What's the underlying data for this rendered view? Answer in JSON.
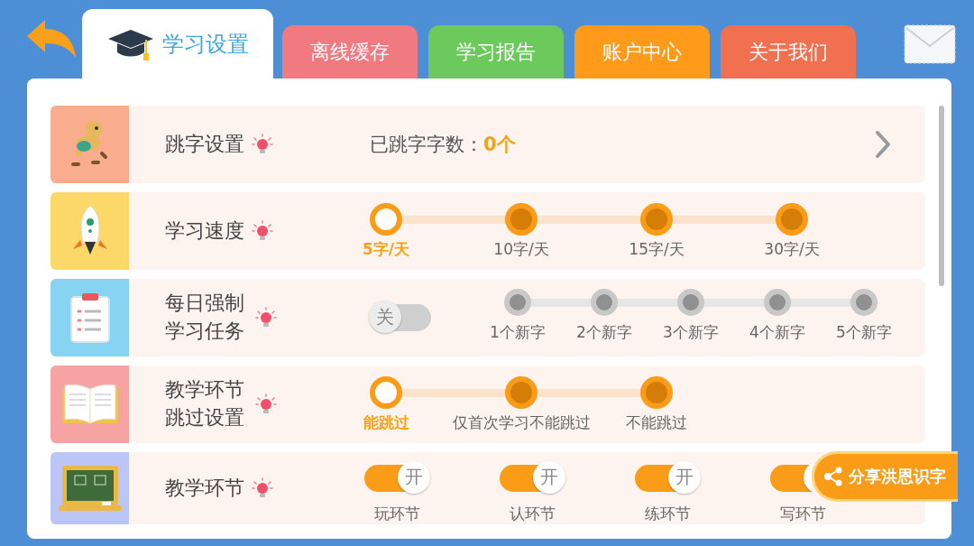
{
  "tabs": [
    {
      "label": "学习设置",
      "selected": true
    },
    {
      "label": "离线缓存",
      "selected": false,
      "color": "#f07a80"
    },
    {
      "label": "学习报告",
      "selected": false,
      "color": "#6cc95c"
    },
    {
      "label": "账户中心",
      "selected": false,
      "color": "#ff9a1a"
    },
    {
      "label": "关于我们",
      "selected": false,
      "color": "#f07050"
    }
  ],
  "rows": [
    {
      "kind": "link",
      "title": "跳字设置",
      "value_label": "已跳字字数：",
      "value": "0个"
    },
    {
      "kind": "steps",
      "title": "学习速度",
      "options": [
        {
          "label": "5字/天",
          "selected": true
        },
        {
          "label": "10字/天",
          "selected": false
        },
        {
          "label": "15字/天",
          "selected": false
        },
        {
          "label": "30字/天",
          "selected": false
        }
      ]
    },
    {
      "kind": "switch_steps",
      "title": "每日强制学习任务",
      "switch": {
        "on": false,
        "text": "关"
      },
      "options": [
        {
          "label": "1个新字",
          "selected": false
        },
        {
          "label": "2个新字",
          "selected": false
        },
        {
          "label": "3个新字",
          "selected": false
        },
        {
          "label": "4个新字",
          "selected": false
        },
        {
          "label": "5个新字",
          "selected": false
        }
      ]
    },
    {
      "kind": "steps",
      "title": "教学环节跳过设置",
      "options": [
        {
          "label": "能跳过",
          "selected": true
        },
        {
          "label": "仅首次学习不能跳过",
          "selected": false
        },
        {
          "label": "不能跳过",
          "selected": false
        }
      ]
    },
    {
      "kind": "switches",
      "title": "教学环节",
      "switches": [
        {
          "label": "玩环节",
          "on": true,
          "text": "开"
        },
        {
          "label": "认环节",
          "on": true,
          "text": "开"
        },
        {
          "label": "练环节",
          "on": true,
          "text": "开"
        },
        {
          "label": "写环节",
          "on": true
        }
      ]
    }
  ],
  "share_button": {
    "label": "分享洪恩识字"
  }
}
